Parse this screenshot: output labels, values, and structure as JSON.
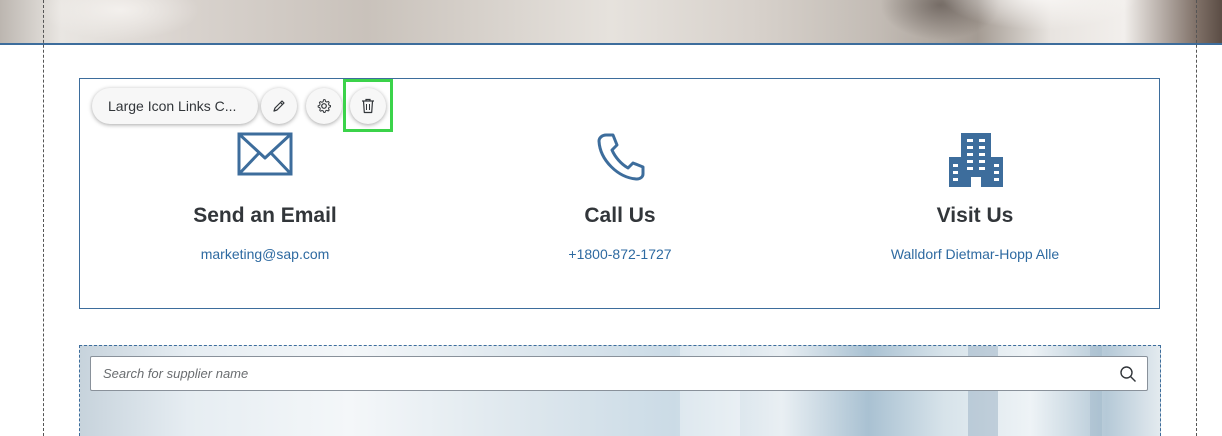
{
  "toolbar": {
    "component_label": "Large Icon Links C...",
    "buttons": [
      {
        "name": "edit",
        "icon": "pencil-icon"
      },
      {
        "name": "settings",
        "icon": "gear-icon"
      },
      {
        "name": "delete",
        "icon": "trash-icon"
      }
    ],
    "highlight_color": "#3bd34a"
  },
  "links": [
    {
      "icon": "envelope-icon",
      "title": "Send an Email",
      "detail": "marketing@sap.com"
    },
    {
      "icon": "phone-icon",
      "title": "Call Us",
      "detail": "+1800-872-1727"
    },
    {
      "icon": "building-icon",
      "title": "Visit Us",
      "detail": "Walldorf Dietmar-Hopp Alle"
    }
  ],
  "search": {
    "placeholder": "Search for supplier name",
    "value": ""
  },
  "colors": {
    "accent": "#3d6d9c",
    "link": "#2e6aa1",
    "text": "#32363a"
  }
}
